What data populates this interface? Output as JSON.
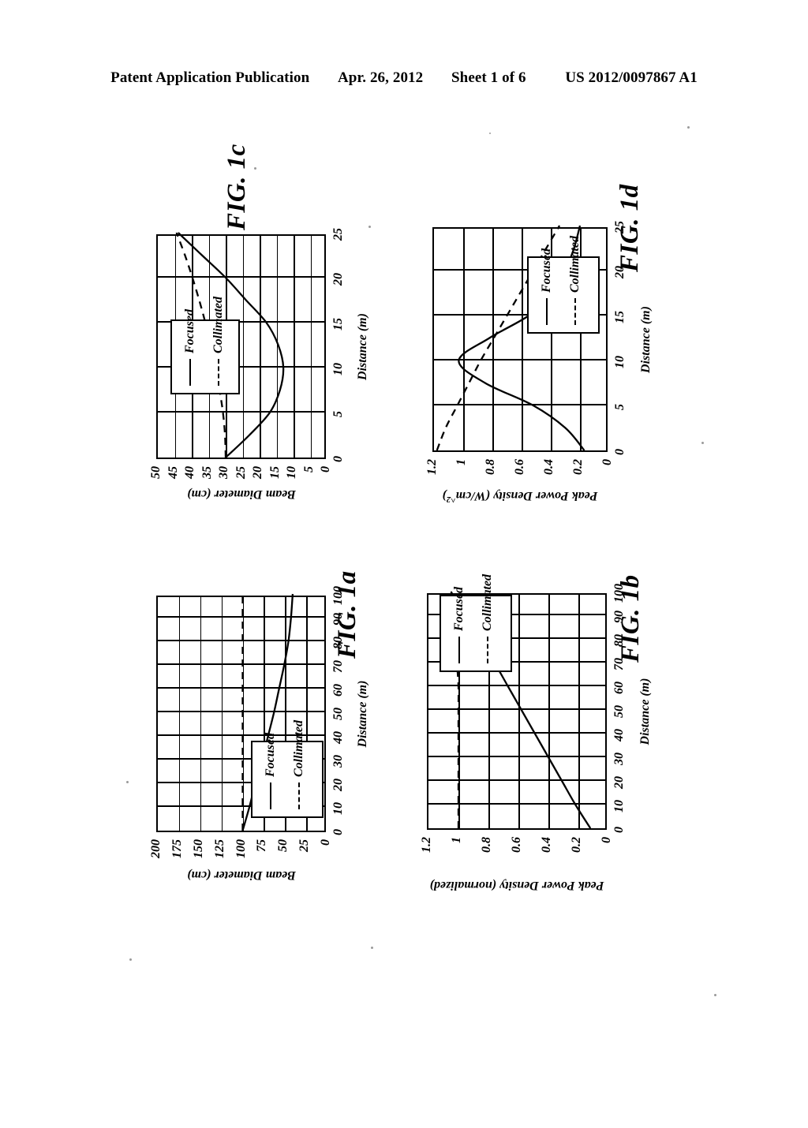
{
  "header": {
    "left": "Patent Application Publication",
    "date": "Apr. 26, 2012",
    "sheet": "Sheet 1 of 6",
    "pubnum": "US 2012/0097867 A1"
  },
  "legend": {
    "focused": "Focused",
    "collimated": "Collimated"
  },
  "figures": {
    "fig1a": {
      "name": "FIG. 1a",
      "xlabel": "Distance (m)",
      "ylabel": "Beam Diameter (cm)"
    },
    "fig1b": {
      "name": "FIG. 1b",
      "xlabel": "Distance (m)",
      "ylabel": "Peak Power Density (normalized)"
    },
    "fig1c": {
      "name": "FIG. 1c",
      "xlabel": "Distance (m)",
      "ylabel": "Beam Diameter (cm)"
    },
    "fig1d": {
      "name": "FIG. 1d",
      "xlabel": "Distance (m)",
      "ylabel": "Peak Power Density (W/cm^2)"
    }
  },
  "chart_data": [
    {
      "id": "fig1a",
      "type": "line",
      "title": "FIG. 1a",
      "xlabel": "Distance (m)",
      "ylabel": "Beam Diameter (cm)",
      "xlim": [
        0,
        100
      ],
      "ylim": [
        0,
        200
      ],
      "xticks": [
        0,
        10,
        20,
        30,
        40,
        50,
        60,
        70,
        80,
        90,
        100
      ],
      "yticks": [
        0,
        25,
        50,
        75,
        100,
        125,
        150,
        175,
        200
      ],
      "grid": true,
      "legend_position": "inside-left",
      "series": [
        {
          "name": "Focused",
          "style": "solid",
          "x": [
            0,
            10,
            20,
            30,
            40,
            50,
            60,
            70,
            80,
            90,
            100
          ],
          "y": [
            100,
            92,
            85,
            77,
            70,
            63,
            57,
            51,
            46,
            43,
            41
          ]
        },
        {
          "name": "Collimated",
          "style": "dashed",
          "x": [
            0,
            10,
            20,
            30,
            40,
            50,
            60,
            70,
            80,
            90,
            100
          ],
          "y": [
            100,
            100,
            100,
            100,
            100,
            100,
            100,
            100,
            100,
            100,
            100
          ]
        }
      ]
    },
    {
      "id": "fig1b",
      "type": "line",
      "title": "FIG. 1b",
      "xlabel": "Distance (m)",
      "ylabel": "Peak Power Density (normalized)",
      "xlim": [
        0,
        100
      ],
      "ylim": [
        0,
        1.2
      ],
      "xticks": [
        0,
        10,
        20,
        30,
        40,
        50,
        60,
        70,
        80,
        90,
        100
      ],
      "yticks": [
        0,
        0.2,
        0.4,
        0.6,
        0.8,
        1,
        1.2
      ],
      "grid": true,
      "legend_position": "inside-right",
      "series": [
        {
          "name": "Focused",
          "style": "solid",
          "x": [
            0,
            10,
            20,
            30,
            40,
            50,
            60,
            70,
            80,
            90,
            100
          ],
          "y": [
            0.12,
            0.22,
            0.31,
            0.4,
            0.49,
            0.58,
            0.67,
            0.76,
            0.86,
            0.96,
            1.05
          ]
        },
        {
          "name": "Collimated",
          "style": "dashed",
          "x": [
            0,
            10,
            20,
            30,
            40,
            50,
            60,
            70,
            80,
            90,
            100
          ],
          "y": [
            1.0,
            1.0,
            1.0,
            1.0,
            1.0,
            1.0,
            1.0,
            1.01,
            1.02,
            1.04,
            1.05
          ]
        }
      ]
    },
    {
      "id": "fig1c",
      "type": "line",
      "title": "FIG. 1c",
      "xlabel": "Distance (m)",
      "ylabel": "Beam Diameter (cm)",
      "xlim": [
        0,
        25
      ],
      "ylim": [
        0,
        50
      ],
      "xticks": [
        0,
        5,
        10,
        15,
        20,
        25
      ],
      "yticks": [
        0,
        5,
        10,
        15,
        20,
        25,
        30,
        35,
        40,
        45,
        50
      ],
      "grid": true,
      "legend_position": "inside-left",
      "series": [
        {
          "name": "Focused",
          "style": "solid",
          "x": [
            0,
            2.5,
            5,
            7.5,
            10,
            12.5,
            15,
            17.5,
            20,
            22.5,
            25
          ],
          "y": [
            30,
            23,
            17,
            14,
            13,
            14.5,
            18,
            24,
            30,
            37,
            44
          ]
        },
        {
          "name": "Collimated",
          "style": "dashed",
          "x": [
            0,
            2.5,
            5,
            7.5,
            10,
            12.5,
            15,
            17.5,
            20,
            22.5,
            25
          ],
          "y": [
            30,
            30.2,
            30.8,
            31.8,
            33,
            34.5,
            36,
            37.8,
            39.8,
            42,
            44.5
          ]
        }
      ]
    },
    {
      "id": "fig1d",
      "type": "line",
      "title": "FIG. 1d",
      "xlabel": "Distance (m)",
      "ylabel": "Peak Power Density (W/cm^2)",
      "xlim": [
        0,
        25
      ],
      "ylim": [
        0,
        1.2
      ],
      "xticks": [
        0,
        5,
        10,
        15,
        20,
        25
      ],
      "yticks": [
        0,
        0.2,
        0.4,
        0.6,
        0.8,
        1,
        1.2
      ],
      "grid": true,
      "legend_position": "inside-right",
      "series": [
        {
          "name": "Focused",
          "style": "solid",
          "x": [
            0,
            2.5,
            5,
            7.5,
            10,
            12.5,
            15,
            17.5,
            20,
            22.5,
            25
          ],
          "y": [
            0.17,
            0.3,
            0.52,
            0.85,
            1.03,
            0.82,
            0.55,
            0.38,
            0.3,
            0.24,
            0.2
          ]
        },
        {
          "name": "Collimated",
          "style": "dashed",
          "x": [
            0,
            2.5,
            5,
            7.5,
            10,
            12.5,
            15,
            17.5,
            20,
            22.5,
            25
          ],
          "y": [
            1.18,
            1.12,
            1.04,
            0.96,
            0.88,
            0.79,
            0.7,
            0.61,
            0.52,
            0.43,
            0.34
          ]
        }
      ]
    }
  ]
}
